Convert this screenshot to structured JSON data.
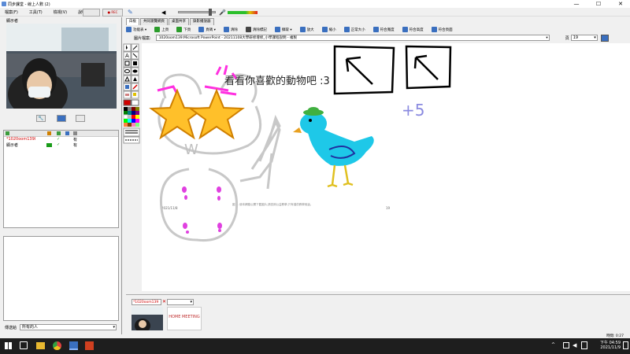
{
  "window": {
    "title": "同步課堂 - 線上人數 (2)",
    "min": "—",
    "max": "☐",
    "close": "✕"
  },
  "menu": [
    "檔案(F)",
    "工具(T)",
    "檢視(V)",
    "說明(H)"
  ],
  "rec_button": "● REC",
  "video": {
    "name": "顯示者"
  },
  "users": {
    "header_icons": [
      "a",
      "a",
      "a",
      "a"
    ],
    "rows": [
      {
        "name": "*1020oom139l",
        "status": "✓",
        "flag": "有",
        "color": "#d00000"
      },
      {
        "name": "顯示者",
        "status": "✓",
        "flag": "有",
        "color": "#000000"
      }
    ]
  },
  "chat": {
    "to_label": "傳送給",
    "to_value": "所有的人"
  },
  "tabs": [
    "白板",
    "共同瀏覽網頁",
    "桌面共享",
    "錄影播放器"
  ],
  "toolbar2": [
    {
      "icon": "menu-icon",
      "label": "功能表 ▾"
    },
    {
      "icon": "prev-icon",
      "label": "上頁"
    },
    {
      "icon": "next-icon",
      "label": "下頁"
    },
    {
      "icon": "page-icon",
      "label": "頁碼 ▾"
    },
    {
      "icon": "clear-icon",
      "label": "清除"
    },
    {
      "icon": "clear-mark-icon",
      "label": "清除標記"
    },
    {
      "icon": "capture-icon",
      "label": "擷取 ▾"
    },
    {
      "icon": "zoom-in-icon",
      "label": "放大"
    },
    {
      "icon": "zoom-out-icon",
      "label": "縮小"
    },
    {
      "icon": "fit-icon",
      "label": "正常大小"
    },
    {
      "icon": "fit-width-icon",
      "label": "符合寬度"
    },
    {
      "icon": "fit-height-icon",
      "label": "符合高度"
    },
    {
      "icon": "fit-page-icon",
      "label": "符合頁面"
    }
  ],
  "doc": {
    "label": "圖片檔案:",
    "file": "1020oom139:Microsoft PowerPoint - 20211108大學研修增修_小學課程說明 - 複製",
    "page_label": "頁",
    "page": "19"
  },
  "canvas": {
    "text": "看看你喜歡的動物吧 :3",
    "plus": "+5",
    "w_letter": "W",
    "slide_date": "2021/11/8",
    "slide_num": "19",
    "slide_footer": "圖 ... 使本網路公開下載圖片,請查詢公益教學,只有僅供教學用途。"
  },
  "thumbs": {
    "select_value": "*1020oom139",
    "logo": "HOME MEETING"
  },
  "status": {
    "time_label": "時間: 0:27"
  },
  "taskbar": {
    "time": "下午 04:59",
    "date": "2021/11/9"
  }
}
